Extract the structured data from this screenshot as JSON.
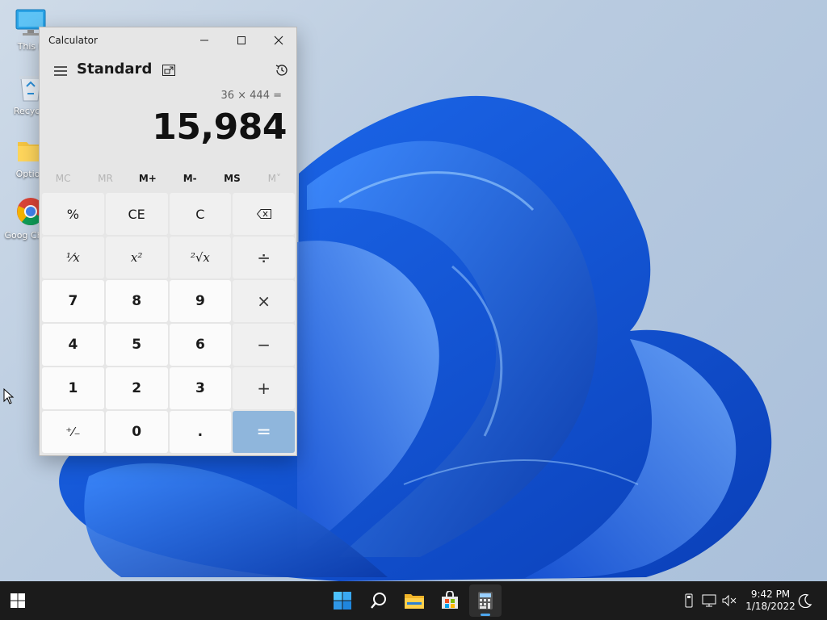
{
  "desktop": {
    "icons": [
      {
        "label": "This P",
        "icon": "monitor-icon"
      },
      {
        "label": "Recycle",
        "icon": "recycle-bin-icon"
      },
      {
        "label": "Option",
        "icon": "folder-icon"
      },
      {
        "label": "Goog Chron",
        "icon": "chrome-icon"
      }
    ]
  },
  "calculator": {
    "window_title": "Calculator",
    "mode": "Standard",
    "expression": "36 × 444 =",
    "result": "15,984",
    "memory": [
      {
        "label": "MC",
        "enabled": false
      },
      {
        "label": "MR",
        "enabled": false
      },
      {
        "label": "M+",
        "enabled": true
      },
      {
        "label": "M-",
        "enabled": true
      },
      {
        "label": "MS",
        "enabled": true
      },
      {
        "label": "M˅",
        "enabled": false
      }
    ],
    "keys": {
      "percent": "%",
      "ce": "CE",
      "clear": "C",
      "backspace": "⌫",
      "reciprocal": "¹⁄x",
      "square": "x²",
      "sqrt": "²√x",
      "divide": "÷",
      "seven": "7",
      "eight": "8",
      "nine": "9",
      "multiply": "×",
      "four": "4",
      "five": "5",
      "six": "6",
      "minus": "−",
      "one": "1",
      "two": "2",
      "three": "3",
      "plus": "+",
      "negate": "⁺⁄₋",
      "zero": "0",
      "decimal": ".",
      "equals": "="
    },
    "accent_color": "#8fb6dc"
  },
  "taskbar": {
    "clock_time": "9:42 PM",
    "clock_date": "1/18/2022",
    "apps": [
      "windows-logo-icon",
      "search-icon",
      "file-explorer-icon",
      "store-icon",
      "calculator-icon"
    ]
  }
}
